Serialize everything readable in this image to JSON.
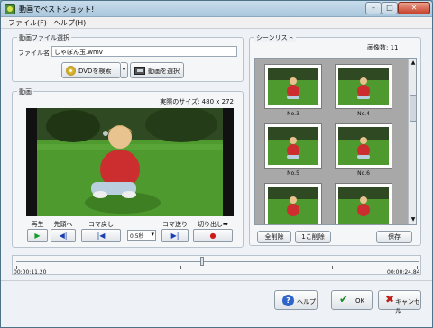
{
  "window": {
    "title": "動画でベストショット!"
  },
  "menu": {
    "file": "ファイル(F)",
    "help": "ヘルプ(H)"
  },
  "file_group": {
    "title": "動画ファイル選択",
    "file_label": "ファイル名",
    "file_value": "しゃぼん玉.wmv",
    "dvd_button": "DVDを検索",
    "select_button": "動画を選択"
  },
  "video_group": {
    "title": "動画",
    "actual_size": "実際のサイズ: 480 x 272",
    "controls": {
      "play": "再生",
      "first": "先頭へ",
      "back": "コマ戻し",
      "step": "0.5秒",
      "forward": "コマ送り",
      "cut": "切り出し➡"
    }
  },
  "scene_group": {
    "title": "シーンリスト",
    "count": "画像数: 11",
    "thumbs": [
      "No.3",
      "No.4",
      "No.5",
      "No.6",
      "",
      ""
    ],
    "delete_all": "全削除",
    "delete_one": "1こ削除",
    "save": "保存"
  },
  "timeline": {
    "start": "00:00:11.20",
    "end": "00:00:24.84"
  },
  "footer": {
    "help": "ヘルプ",
    "ok": "OK",
    "cancel": "キャンセル"
  }
}
